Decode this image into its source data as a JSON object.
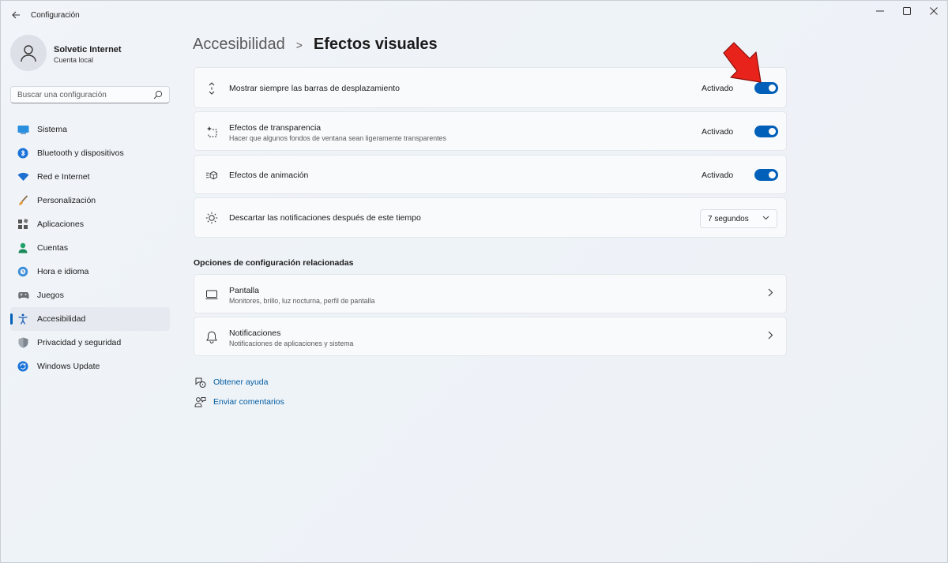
{
  "window": {
    "title": "Configuración",
    "controls": [
      "minimize",
      "maximize",
      "close"
    ]
  },
  "profile": {
    "name": "Solvetic Internet",
    "account_type": "Cuenta local"
  },
  "search": {
    "placeholder": "Buscar una configuración"
  },
  "sidebar": {
    "items": [
      {
        "label": "Sistema",
        "icon": "system-icon",
        "active": false
      },
      {
        "label": "Bluetooth y dispositivos",
        "icon": "bluetooth-icon",
        "active": false
      },
      {
        "label": "Red e Internet",
        "icon": "wifi-icon",
        "active": false
      },
      {
        "label": "Personalización",
        "icon": "brush-icon",
        "active": false
      },
      {
        "label": "Aplicaciones",
        "icon": "apps-icon",
        "active": false
      },
      {
        "label": "Cuentas",
        "icon": "accounts-icon",
        "active": false
      },
      {
        "label": "Hora e idioma",
        "icon": "globe-clock-icon",
        "active": false
      },
      {
        "label": "Juegos",
        "icon": "gamepad-icon",
        "active": false
      },
      {
        "label": "Accesibilidad",
        "icon": "accessibility-icon",
        "active": true
      },
      {
        "label": "Privacidad y seguridad",
        "icon": "shield-icon",
        "active": false
      },
      {
        "label": "Windows Update",
        "icon": "update-icon",
        "active": false
      }
    ]
  },
  "breadcrumb": {
    "parent": "Accesibilidad",
    "separator": ">",
    "current": "Efectos visuales"
  },
  "settings": [
    {
      "title": "Mostrar siempre las barras de desplazamiento",
      "state": "Activado",
      "on": true,
      "icon": "scrollbar-icon"
    },
    {
      "title": "Efectos de transparencia",
      "description": "Hacer que algunos fondos de ventana sean ligeramente transparentes",
      "state": "Activado",
      "on": true,
      "icon": "transparency-icon"
    },
    {
      "title": "Efectos de animación",
      "state": "Activado",
      "on": true,
      "icon": "animation-icon"
    },
    {
      "title": "Descartar las notificaciones después de este tiempo",
      "value": "7 segundos",
      "icon": "brightness-icon"
    }
  ],
  "related": {
    "heading": "Opciones de configuración relacionadas",
    "items": [
      {
        "title": "Pantalla",
        "description": "Monitores, brillo, luz nocturna, perfil de pantalla",
        "icon": "monitor-icon"
      },
      {
        "title": "Notificaciones",
        "description": "Notificaciones de aplicaciones y sistema",
        "icon": "bell-icon"
      }
    ]
  },
  "links": {
    "help": "Obtener ayuda",
    "feedback": "Enviar comentarios"
  },
  "colors": {
    "accent": "#005fb8",
    "link": "#005a9e",
    "arrow": "#e8231b"
  }
}
